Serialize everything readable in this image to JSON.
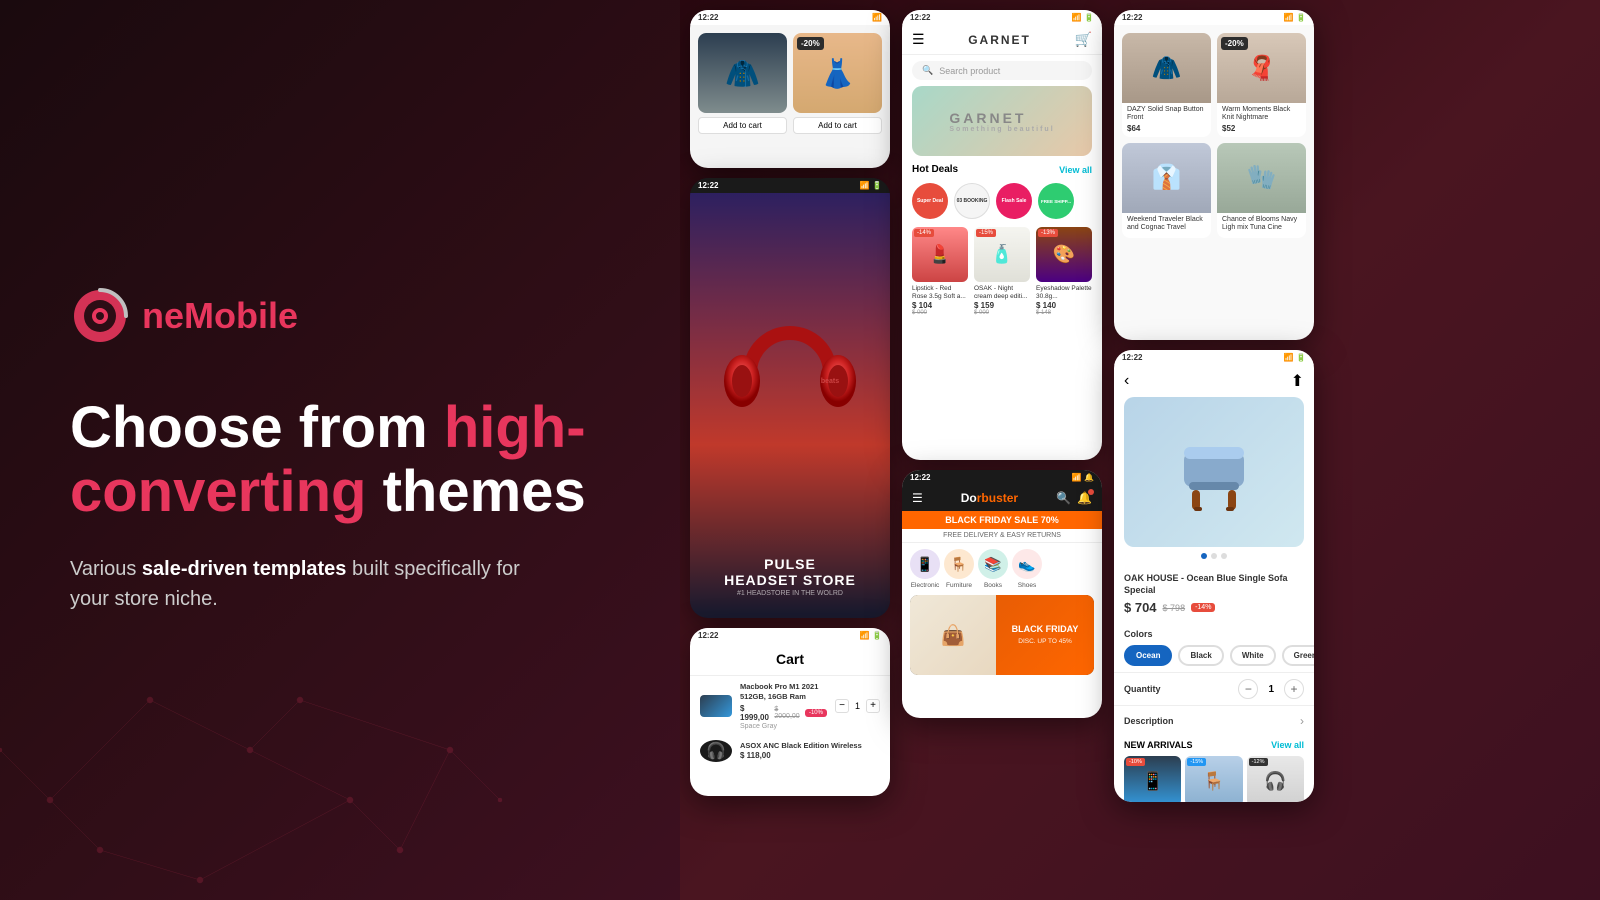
{
  "brand": {
    "name_one": "ne",
    "name_mobile": "Mobile",
    "tagline_part1": "Choose from ",
    "tagline_highlight1": "high-",
    "tagline_highlight2": "converting",
    "tagline_part2": " themes",
    "subtext_plain": "Various ",
    "subtext_bold": "sale-driven templates",
    "subtext_end": " built specifically for your store niche."
  },
  "phone1_top": {
    "status": "12:22",
    "discount": "-20%",
    "btn1": "Add to cart",
    "btn2": "Add to cart"
  },
  "phone_headset": {
    "status": "12:22",
    "title": "PULSE",
    "subtitle": "HEADSET STORE",
    "tagline": "#1 HEADSTORE IN THE WOLRD"
  },
  "phone_cart": {
    "status": "12:22",
    "title": "Cart",
    "item1_name": "Macbook Pro M1 2021 512GB, 16GB Ram",
    "item1_price": "$ 1999,00",
    "item1_old_price": "$ 2000,00",
    "item1_discount": "-10%",
    "item1_color": "Space Gray",
    "item1_qty": "1",
    "item2_name": "ASOX ANC Black Edition Wireless",
    "item2_price": "$ 118,00"
  },
  "phone_garnet": {
    "status": "12:22",
    "store_name": "GARNET",
    "search_placeholder": "Search product",
    "banner_text": "GARNET",
    "hot_deals": "Hot Deals",
    "view_all": "View all",
    "badge1": "Super Deal",
    "badge2": "03 BOOKING",
    "badge3": "Flash Sale",
    "badge4": "FREE SHIPP...",
    "product1_name": "Lipstick - Red Rose 3.5g Soft a...",
    "product1_price": "$ 104",
    "product1_old": "$ 000",
    "product1_badge": "-14%",
    "product2_name": "OSAK - Night cream deep editi...",
    "product2_price": "$ 159",
    "product2_old": "$ 000",
    "product2_badge": "-15%",
    "product3_name": "Eyeshadow Palette 30.8g...",
    "product3_price": "$ 140",
    "product3_old": "$ 148",
    "product3_badge": "-13%"
  },
  "phone_doorbuster": {
    "status": "12:22",
    "store_name": "Do",
    "store_name2": "rbuster",
    "sale_banner": "BLACK FRIDAY SALE 70%",
    "delivery": "FREE DELIVERY & EASY RETURNS",
    "cat1": "Electronic",
    "cat2": "Furniture",
    "cat3": "Books",
    "cat4": "Shoes",
    "bf_title": "BLACK FRIDAY",
    "bf_subtitle": "DISC. UP TO 45%"
  },
  "phone_fashion_store": {
    "status": "12:22",
    "item1_name": "DAZY Solid Snap Button Front",
    "item1_price": "$64",
    "item2_name": "Warm Moments Black Knit Nightmare",
    "item2_price": "$52",
    "item2_discount": "-20%",
    "item3_name": "Weekend Traveler Black and Cognac Travel",
    "item3_price": "",
    "item4_name": "Chance of Blooms Navy Ligh mix Tuna Cine",
    "item4_price": ""
  },
  "phone_product": {
    "status": "12:22",
    "product_name": "OAK HOUSE - Ocean Blue Single Sofa Special",
    "price": "$ 704",
    "old_price": "$ 798",
    "discount": "-14%",
    "colors_label": "Colors",
    "color1": "Ocean",
    "color2": "Black",
    "color3": "White",
    "color4": "Green",
    "qty_label": "Quantity",
    "qty_value": "1",
    "desc_label": "Description",
    "new_arrivals": "NEW ARRIVALS",
    "view_all": "View all"
  }
}
